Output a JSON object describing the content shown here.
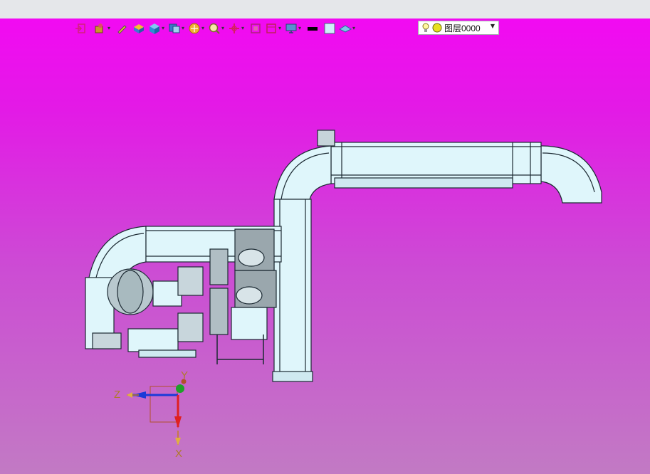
{
  "toolbar": {
    "items": [
      {
        "name": "exit-sketch-icon",
        "dropdown": false
      },
      {
        "name": "select-filter-icon",
        "dropdown": true
      },
      {
        "name": "pencil-icon",
        "dropdown": false
      },
      {
        "name": "box-yellow-icon",
        "dropdown": false
      },
      {
        "name": "cube-icon",
        "dropdown": true
      },
      {
        "name": "view-cube-icon",
        "dropdown": true
      },
      {
        "name": "section-view-icon",
        "dropdown": true
      },
      {
        "name": "zoom-icon",
        "dropdown": true
      },
      {
        "name": "pan-icon",
        "dropdown": true
      },
      {
        "name": "fit-view-icon",
        "dropdown": false
      },
      {
        "name": "orient-view-icon",
        "dropdown": true
      },
      {
        "name": "display-monitor-icon",
        "dropdown": true
      },
      {
        "name": "line-color-swatch-icon",
        "dropdown": false
      },
      {
        "name": "fill-color-swatch-icon",
        "dropdown": false
      },
      {
        "name": "layer-plane-icon",
        "dropdown": true
      }
    ]
  },
  "layer": {
    "value": "图层0000",
    "icons": [
      "lightbulb-icon",
      "layer-color-dot-icon"
    ]
  },
  "triad": {
    "y_label": "Y",
    "z_label": "Z",
    "x_label": "X"
  },
  "colors": {
    "viewport_top": "#f20af2",
    "viewport_bottom": "#c27ac4",
    "duct_fill": "#dff6fb",
    "duct_edge": "#1c2a33",
    "equipment_gray": "#9aa7ad"
  }
}
